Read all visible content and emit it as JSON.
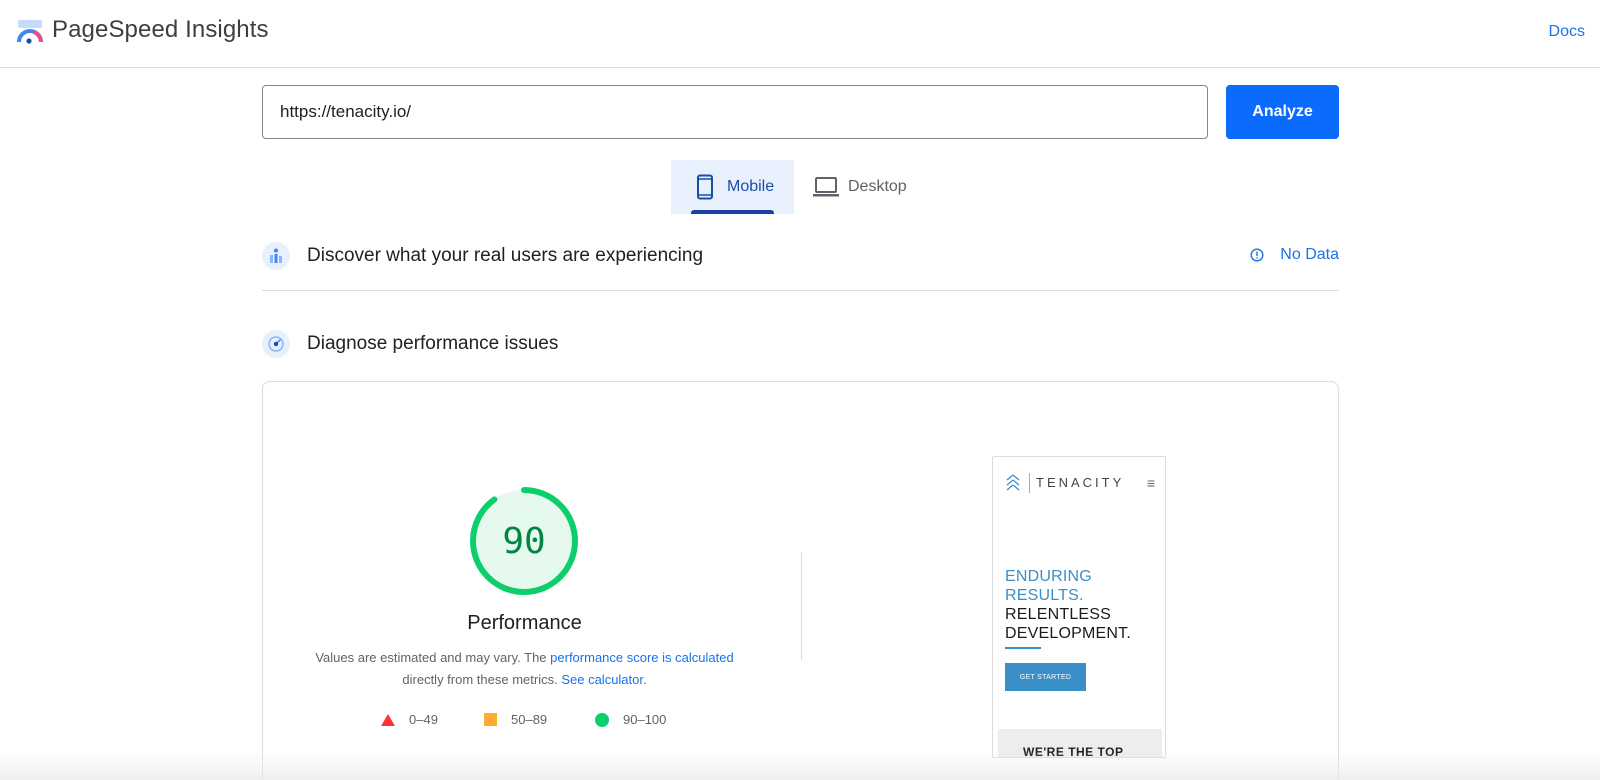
{
  "header": {
    "app_title": "PageSpeed Insights",
    "logo_icon": "pagespeed-logo-icon",
    "docs_label": "Docs"
  },
  "search": {
    "url_value": "https://tenacity.io/",
    "analyze_label": "Analyze"
  },
  "tabs": [
    {
      "label": "Mobile",
      "icon": "phone-icon",
      "selected": true
    },
    {
      "label": "Desktop",
      "icon": "laptop-icon",
      "selected": false
    }
  ],
  "field_data": {
    "title": "Discover what your real users are experiencing",
    "status_label": "No Data",
    "icon": "users-chart-icon"
  },
  "lab_data": {
    "title": "Diagnose performance issues",
    "icon": "gauge-icon"
  },
  "performance": {
    "score": "90",
    "score_fraction": 0.9,
    "title": "Performance",
    "desc_prefix": "Values are estimated and may vary. The ",
    "desc_link1": "performance score is calculated",
    "desc_middle": " directly from these metrics. ",
    "desc_link2": "See calculator.",
    "legend": [
      {
        "label": "0–49",
        "shape": "triangle",
        "color": "#ff3333"
      },
      {
        "label": "50–89",
        "shape": "square",
        "color": "#ffaa33"
      },
      {
        "label": "90–100",
        "shape": "circle",
        "color": "#0cce6b"
      }
    ]
  },
  "screenshot": {
    "brand": "TENACITY",
    "headline_blue_1": "ENDURING",
    "headline_blue_2": "RESULTS.",
    "headline_dark_1": "RELENTLESS",
    "headline_dark_2": "DEVELOPMENT.",
    "cta_label": "GET STARTED",
    "band_text": "WE'RE THE TOP"
  },
  "colors": {
    "accent": "#1a73e8",
    "analyze_button": "#0b6bfd",
    "score_good": "#0cce6b",
    "score_text": "#018642"
  }
}
